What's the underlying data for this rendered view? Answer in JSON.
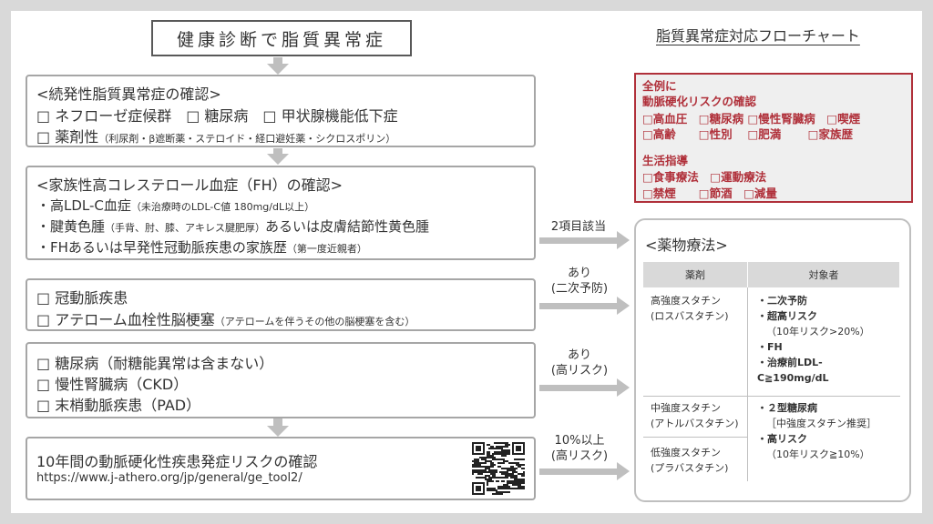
{
  "title": "健康診断で脂質異常症",
  "flow_title": "脂質異常症対応フローチャート",
  "box1": {
    "heading": "<続発性脂質異常症の確認>",
    "row1": "□ ネフローゼ症候群　□ 糖尿病　□ 甲状腺機能低下症",
    "row2_main": "□ 薬剤性",
    "row2_note": "（利尿剤・β遮断薬・ステロイド・経口避妊薬・シクロスポリン）"
  },
  "box2": {
    "heading": "<家族性高コレステロール血症（FH）の確認>",
    "item1_main": "・高LDL-C血症",
    "item1_note": "（未治療時のLDL-C値 180mg/dL以上）",
    "item2_a": "・腱黄色腫",
    "item2_note": "（手背、肘、膝、アキレス腱肥厚）",
    "item2_b": "あるいは皮膚結節性黄色腫",
    "item3_main": "・FHあるいは早発性冠動脈疾患の家族歴",
    "item3_note": "（第一度近親者）"
  },
  "box3": {
    "row1": "□ 冠動脈疾患",
    "row2_main": "□ アテローム血栓性脳梗塞",
    "row2_note": "（アテロームを伴うその他の脳梗塞を含む）"
  },
  "box4": {
    "row1": "□ 糖尿病（耐糖能異常は含まない）",
    "row2": "□ 慢性腎臓病（CKD）",
    "row3": "□ 末梢動脈疾患（PAD）"
  },
  "box5": {
    "heading": "10年間の動脈硬化性疾患発症リスクの確認",
    "url": "https://www.j-athero.org/jp/general/ge_tool2/"
  },
  "arrows": {
    "a1": "2項目該当",
    "a2_l1": "あり",
    "a2_l2": "(二次予防)",
    "a3_l1": "あり",
    "a3_l2": "(高リスク)",
    "a4_l1": "10%以上",
    "a4_l2": "(高リスク)"
  },
  "redbox": {
    "h1": "全例に",
    "h2": "動脈硬化リスクの確認",
    "r1": "□高血圧　□糖尿病 □慢性腎臓病　□喫煙",
    "r2": "□高齢　　□性別　 □肥満　　 □家族歴",
    "h3": "生活指導",
    "r3": "□食事療法　□運動療法",
    "r4": "□禁煙　　□節酒　□減量"
  },
  "drug": {
    "heading": "<薬物療法>",
    "col1": "薬剤",
    "col2": "対象者",
    "high_l1": "高強度スタチン",
    "high_l2": "(ロスバスタチン)",
    "t1": "・二次予防",
    "t2": "・超高リスク",
    "t3": "（10年リスク>20%）",
    "t4": "・FH",
    "t5": "・治療前LDL-C≧190mg/dL",
    "mid_l1": "中強度スタチン",
    "mid_l2": "(アトルバスタチン)",
    "low_l1": "低強度スタチン",
    "low_l2": "(プラバスタチン)",
    "m1": "・２型糖尿病",
    "m2": "［中強度スタチン推奨］",
    "m3": "・高リスク",
    "m4": "（10年リスク≧10%）"
  },
  "colors": {
    "accent_red": "#b0303a",
    "arrow_gray": "#bfbfbf",
    "border_gray": "#a6a6a6"
  }
}
